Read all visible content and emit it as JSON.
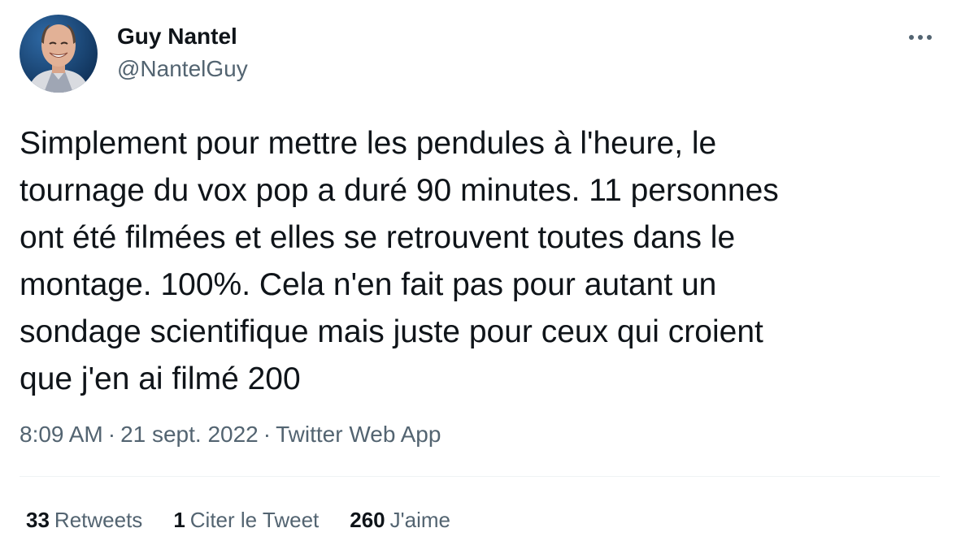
{
  "author": {
    "display_name": "Guy Nantel",
    "handle": "@NantelGuy",
    "avatar_icon": "profile-photo"
  },
  "more_icon": "more-horizontal-icon",
  "tweet": {
    "text": "Simplement pour mettre les pendules à l'heure, le\ntournage du vox pop a duré 90 minutes. 11 personnes\nont été filmées et elles se retrouvent toutes dans le\nmontage. 100%. Cela n'en fait pas pour autant un\nsondage scientifique mais juste pour ceux qui croient\nque j'en ai filmé 200",
    "time": "8:09 AM",
    "date": "21 sept. 2022",
    "source": "Twitter Web App",
    "separator": "·"
  },
  "stats": {
    "retweets_count": "33",
    "retweets_label": "Retweets",
    "quotes_count": "1",
    "quotes_label": "Citer le Tweet",
    "likes_count": "260",
    "likes_label": "J'aime"
  },
  "colors": {
    "primary_text": "#0f1419",
    "secondary_text": "#536471",
    "divider": "#eff3f4",
    "avatar_background": "#1a4a7a"
  }
}
